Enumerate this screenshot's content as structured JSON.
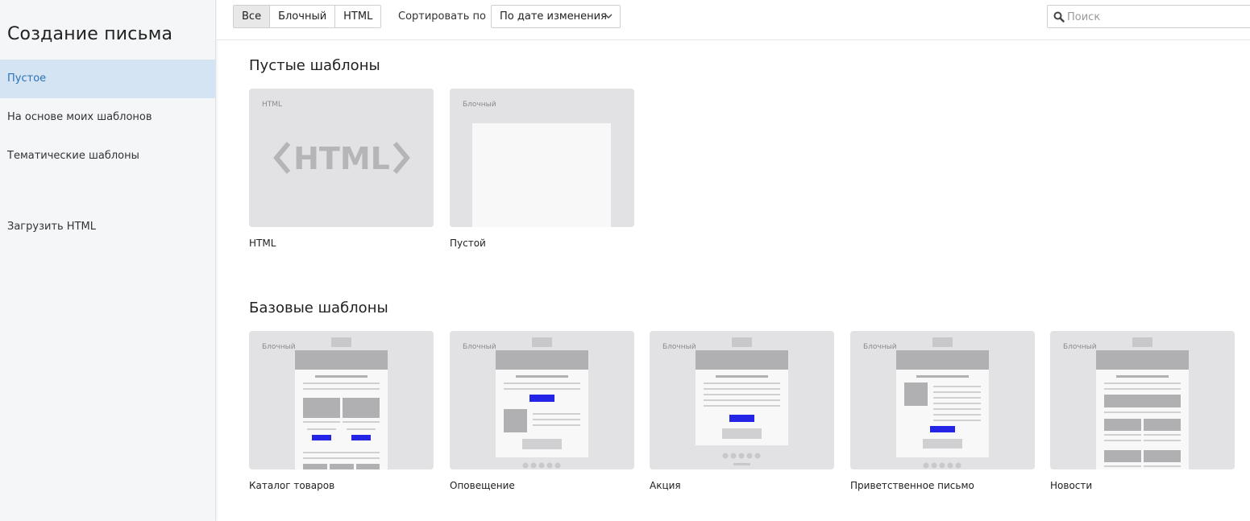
{
  "sidebar": {
    "title": "Создание письма",
    "items": [
      {
        "label": "Пустое",
        "active": true
      },
      {
        "label": "На основе моих шаблонов",
        "active": false
      },
      {
        "label": "Тематические шаблоны",
        "active": false
      },
      {
        "label": "Загрузить HTML",
        "active": false
      }
    ]
  },
  "toolbar": {
    "filters": [
      "Все",
      "Блочный",
      "HTML"
    ],
    "active_filter": "Все",
    "sort_label": "Сортировать по",
    "sort_value": "По дате изменения",
    "search_placeholder": "Поиск",
    "search_value": ""
  },
  "sections": {
    "empty": {
      "title": "Пустые шаблоны",
      "cards": [
        {
          "tag": "HTML",
          "name": "HTML",
          "logo_text": "HTML"
        },
        {
          "tag": "Блочный",
          "name": "Пустой"
        }
      ]
    },
    "basic": {
      "title": "Базовые шаблоны",
      "cards": [
        {
          "tag": "Блочный",
          "name": "Каталог товаров"
        },
        {
          "tag": "Блочный",
          "name": "Оповещение"
        },
        {
          "tag": "Блочный",
          "name": "Акция"
        },
        {
          "tag": "Блочный",
          "name": "Приветственное письмо"
        },
        {
          "tag": "Блочный",
          "name": "Новости"
        }
      ]
    }
  },
  "colors": {
    "accent": "#2a72b8",
    "active_bg": "#d5e4f2",
    "cta_blue": "#2424e6",
    "thumb_bg": "#e2e2e4"
  },
  "icons": [
    "search-icon",
    "chevron-down-icon"
  ]
}
